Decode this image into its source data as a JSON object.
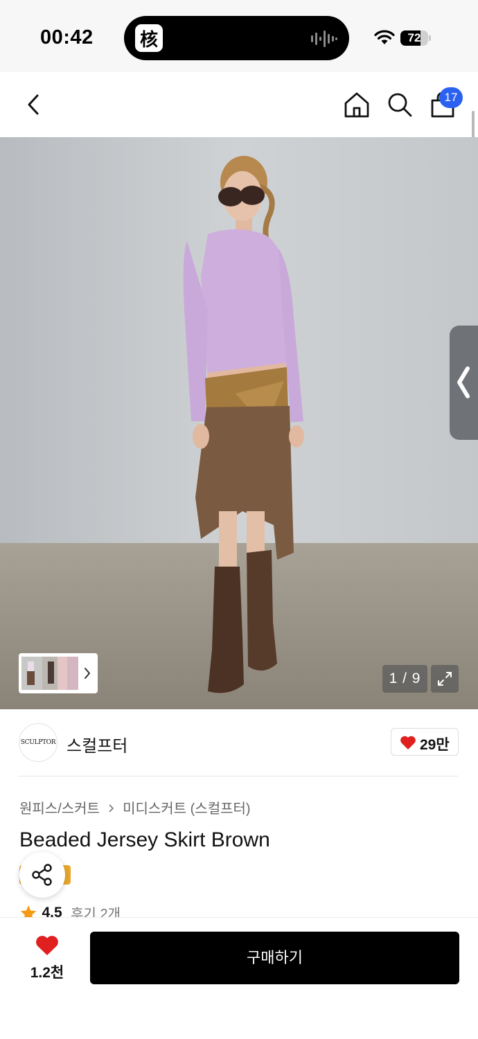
{
  "status_bar": {
    "time": "00:42",
    "island_app_glyph": "核",
    "battery_percent": "72",
    "battery_level": 0.72
  },
  "nav": {
    "icons": [
      "chevron-left-icon",
      "home-icon",
      "search-icon",
      "shopping-bag-icon"
    ],
    "cart_count": "17"
  },
  "gallery": {
    "counter": "1 / 9",
    "current_index": 1,
    "total": 9
  },
  "brand": {
    "logo_text": "SCULPTOR",
    "name": "스컬프터",
    "likes": "29만"
  },
  "product": {
    "breadcrumb": [
      "원피스/스커트",
      "미디스커트 (스컬프터)"
    ],
    "title": "Beaded Jersey Skirt Brown",
    "rating": "4.5",
    "reviews": "후기 2개"
  },
  "bottom_bar": {
    "wishlist_count": "1.2천",
    "buy_label": "구매하기"
  },
  "colors": {
    "accent_blue": "#2a61f0",
    "heart_red": "#e0201e",
    "star_orange": "#f59a12",
    "buy_button": "#000000"
  }
}
